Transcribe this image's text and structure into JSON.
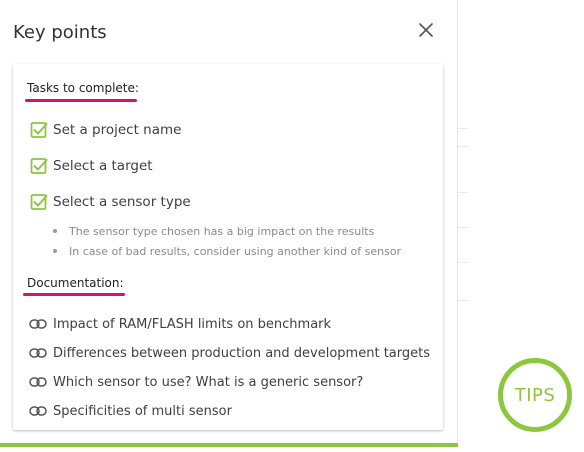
{
  "panel": {
    "title": "Key points",
    "close_icon": "close-icon"
  },
  "tasks": {
    "heading": "Tasks to complete:",
    "items": [
      {
        "label": "Set a project name",
        "checked": true
      },
      {
        "label": "Select a target",
        "checked": true
      },
      {
        "label": "Select a sensor type",
        "checked": true
      }
    ],
    "hints": [
      "The sensor type chosen has a big impact on the results",
      "In case of bad results, consider using another kind of sensor"
    ]
  },
  "documentation": {
    "heading": "Documentation:",
    "links": [
      "Impact of RAM/FLASH limits on benchmark",
      "Differences between production and development targets",
      "Which sensor to use? What is a generic sensor?",
      "Specificities of multi sensor"
    ]
  },
  "tips_button": {
    "label": "TIPS"
  },
  "colors": {
    "accent_green": "#8dc63f",
    "underline_pink": "#d4146d"
  }
}
